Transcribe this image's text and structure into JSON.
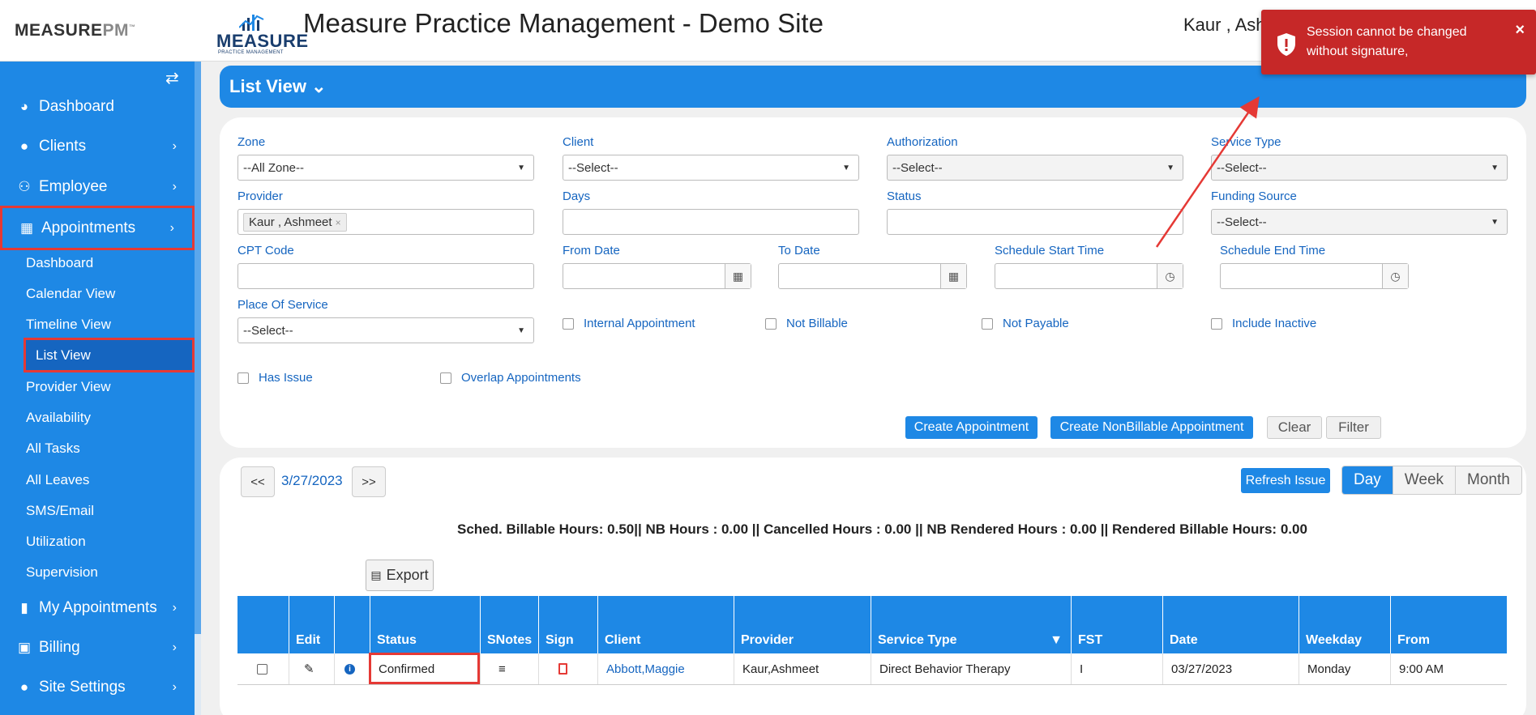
{
  "header": {
    "brand_left": "MEASURE",
    "brand_left_pm": "PM",
    "brand_left_tm": "™",
    "logo_word": "MEASURE",
    "logo_sub": "PRACTICE MANAGEMENT",
    "site_title": "Measure Practice Management - Demo Site",
    "user_name": "Kaur , Ash"
  },
  "sidebar": {
    "items": [
      {
        "label": "Dashboard"
      },
      {
        "label": "Clients"
      },
      {
        "label": "Employee"
      },
      {
        "label": "Appointments"
      },
      {
        "label": "My Appointments"
      },
      {
        "label": "Billing"
      },
      {
        "label": "Site Settings"
      }
    ],
    "sub_items": [
      {
        "label": "Dashboard"
      },
      {
        "label": "Calendar View"
      },
      {
        "label": "Timeline View"
      },
      {
        "label": "List View"
      },
      {
        "label": "Provider View"
      },
      {
        "label": "Availability"
      },
      {
        "label": "All Tasks"
      },
      {
        "label": "All Leaves"
      },
      {
        "label": "SMS/Email"
      },
      {
        "label": "Utilization"
      },
      {
        "label": "Supervision"
      }
    ]
  },
  "list_view": {
    "title": "List View"
  },
  "filters": {
    "zone": {
      "label": "Zone",
      "value": "--All Zone--"
    },
    "client": {
      "label": "Client",
      "value": "--Select--"
    },
    "authorization": {
      "label": "Authorization",
      "value": "--Select--"
    },
    "service_type": {
      "label": "Service Type",
      "value": "--Select--"
    },
    "provider": {
      "label": "Provider",
      "tag": "Kaur , Ashmeet",
      "tag_remove": "×"
    },
    "days": {
      "label": "Days",
      "value": ""
    },
    "status": {
      "label": "Status",
      "value": ""
    },
    "funding_source": {
      "label": "Funding Source",
      "value": "--Select--"
    },
    "cpt_code": {
      "label": "CPT Code",
      "value": ""
    },
    "from_date": {
      "label": "From Date",
      "value": ""
    },
    "to_date": {
      "label": "To Date",
      "value": ""
    },
    "schedule_start": {
      "label": "Schedule Start Time",
      "value": ""
    },
    "schedule_end": {
      "label": "Schedule End Time",
      "value": ""
    },
    "place_of_service": {
      "label": "Place Of Service",
      "value": "--Select--"
    },
    "checkboxes": {
      "internal": "Internal Appointment",
      "not_billable": "Not Billable",
      "not_payable": "Not Payable",
      "include_inactive": "Include Inactive",
      "has_issue": "Has Issue",
      "overlap": "Overlap Appointments"
    },
    "buttons": {
      "create": "Create Appointment",
      "create_nonbillable": "Create NonBillable Appointment",
      "clear": "Clear",
      "filter": "Filter"
    }
  },
  "results": {
    "prev": "<<",
    "next": ">>",
    "date": "3/27/2023",
    "refresh_issue": "Refresh Issue",
    "views": {
      "day": "Day",
      "week": "Week",
      "month": "Month",
      "active": "Day"
    },
    "summary": "Sched. Billable Hours: 0.50|| NB Hours : 0.00 || Cancelled Hours : 0.00 || NB Rendered Hours : 0.00 || Rendered Billable Hours: 0.00",
    "export": "Export",
    "columns": [
      "",
      "Edit",
      "",
      "Status",
      "SNotes",
      "Sign",
      "Client",
      "Provider",
      "Service Type",
      "FST",
      "Date",
      "Weekday",
      "From"
    ],
    "rows": [
      {
        "status": "Confirmed",
        "client": "Abbott,Maggie",
        "provider": "Kaur,Ashmeet",
        "service_type": "Direct Behavior Therapy",
        "fst": "I",
        "date": "03/27/2023",
        "weekday": "Monday",
        "from": "9:00 AM"
      }
    ]
  },
  "toast": {
    "message": "Session cannot be changed without signature,",
    "close": "×"
  },
  "colors": {
    "primary": "#1e88e5",
    "highlight": "#e53935",
    "toast": "#c62828"
  }
}
